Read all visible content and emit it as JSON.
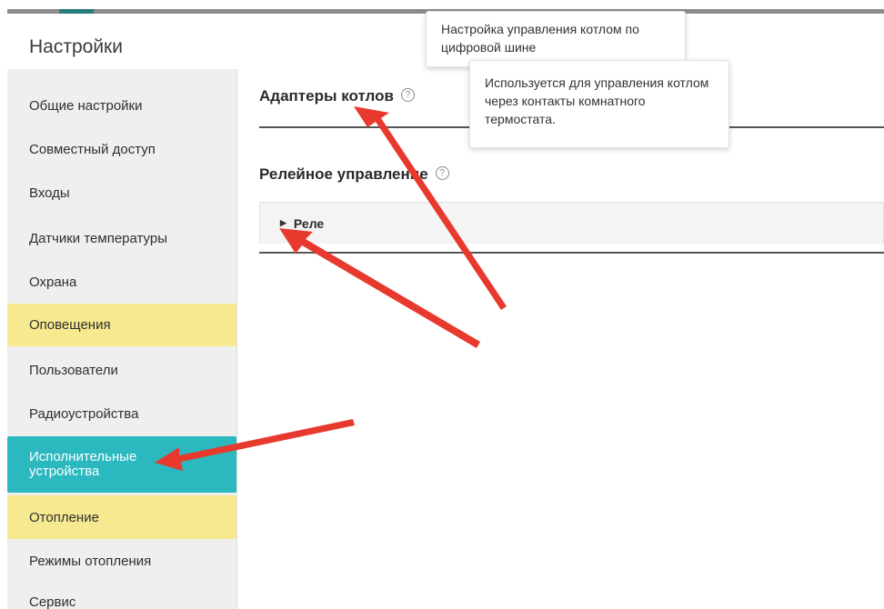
{
  "header": {
    "title": "Настройки"
  },
  "sidebar": {
    "items": [
      {
        "label": "Общие настройки"
      },
      {
        "label": "Совместный доступ"
      },
      {
        "label": "Входы"
      },
      {
        "label": "Датчики температуры"
      },
      {
        "label": "Охрана"
      },
      {
        "label": "Оповещения"
      },
      {
        "label": "Пользователи"
      },
      {
        "label": "Радиоустройства"
      },
      {
        "label": "Исполнительные устройства"
      },
      {
        "label": "Отопление"
      },
      {
        "label": "Режимы отопления"
      },
      {
        "label": "Сервис"
      }
    ]
  },
  "main": {
    "boiler_adapters": {
      "title": "Адаптеры котлов",
      "help_icon": "help-circle-icon"
    },
    "relay_control": {
      "title": "Релейное управление",
      "help_icon": "help-circle-icon"
    },
    "relay_accordion": {
      "label": "Реле",
      "icon": "caret-right-icon"
    }
  },
  "tooltips": {
    "boiler_adapters": "Настройка управления котлом по цифровой шине",
    "relay_control": "Используется для управления котлом через контакты комнатного термостата."
  },
  "colors": {
    "active_item": "#2bb8bf",
    "highlight_item": "#f7e98f",
    "sidebar_bg": "#efefef",
    "annotation_arrow": "#e8392f"
  }
}
